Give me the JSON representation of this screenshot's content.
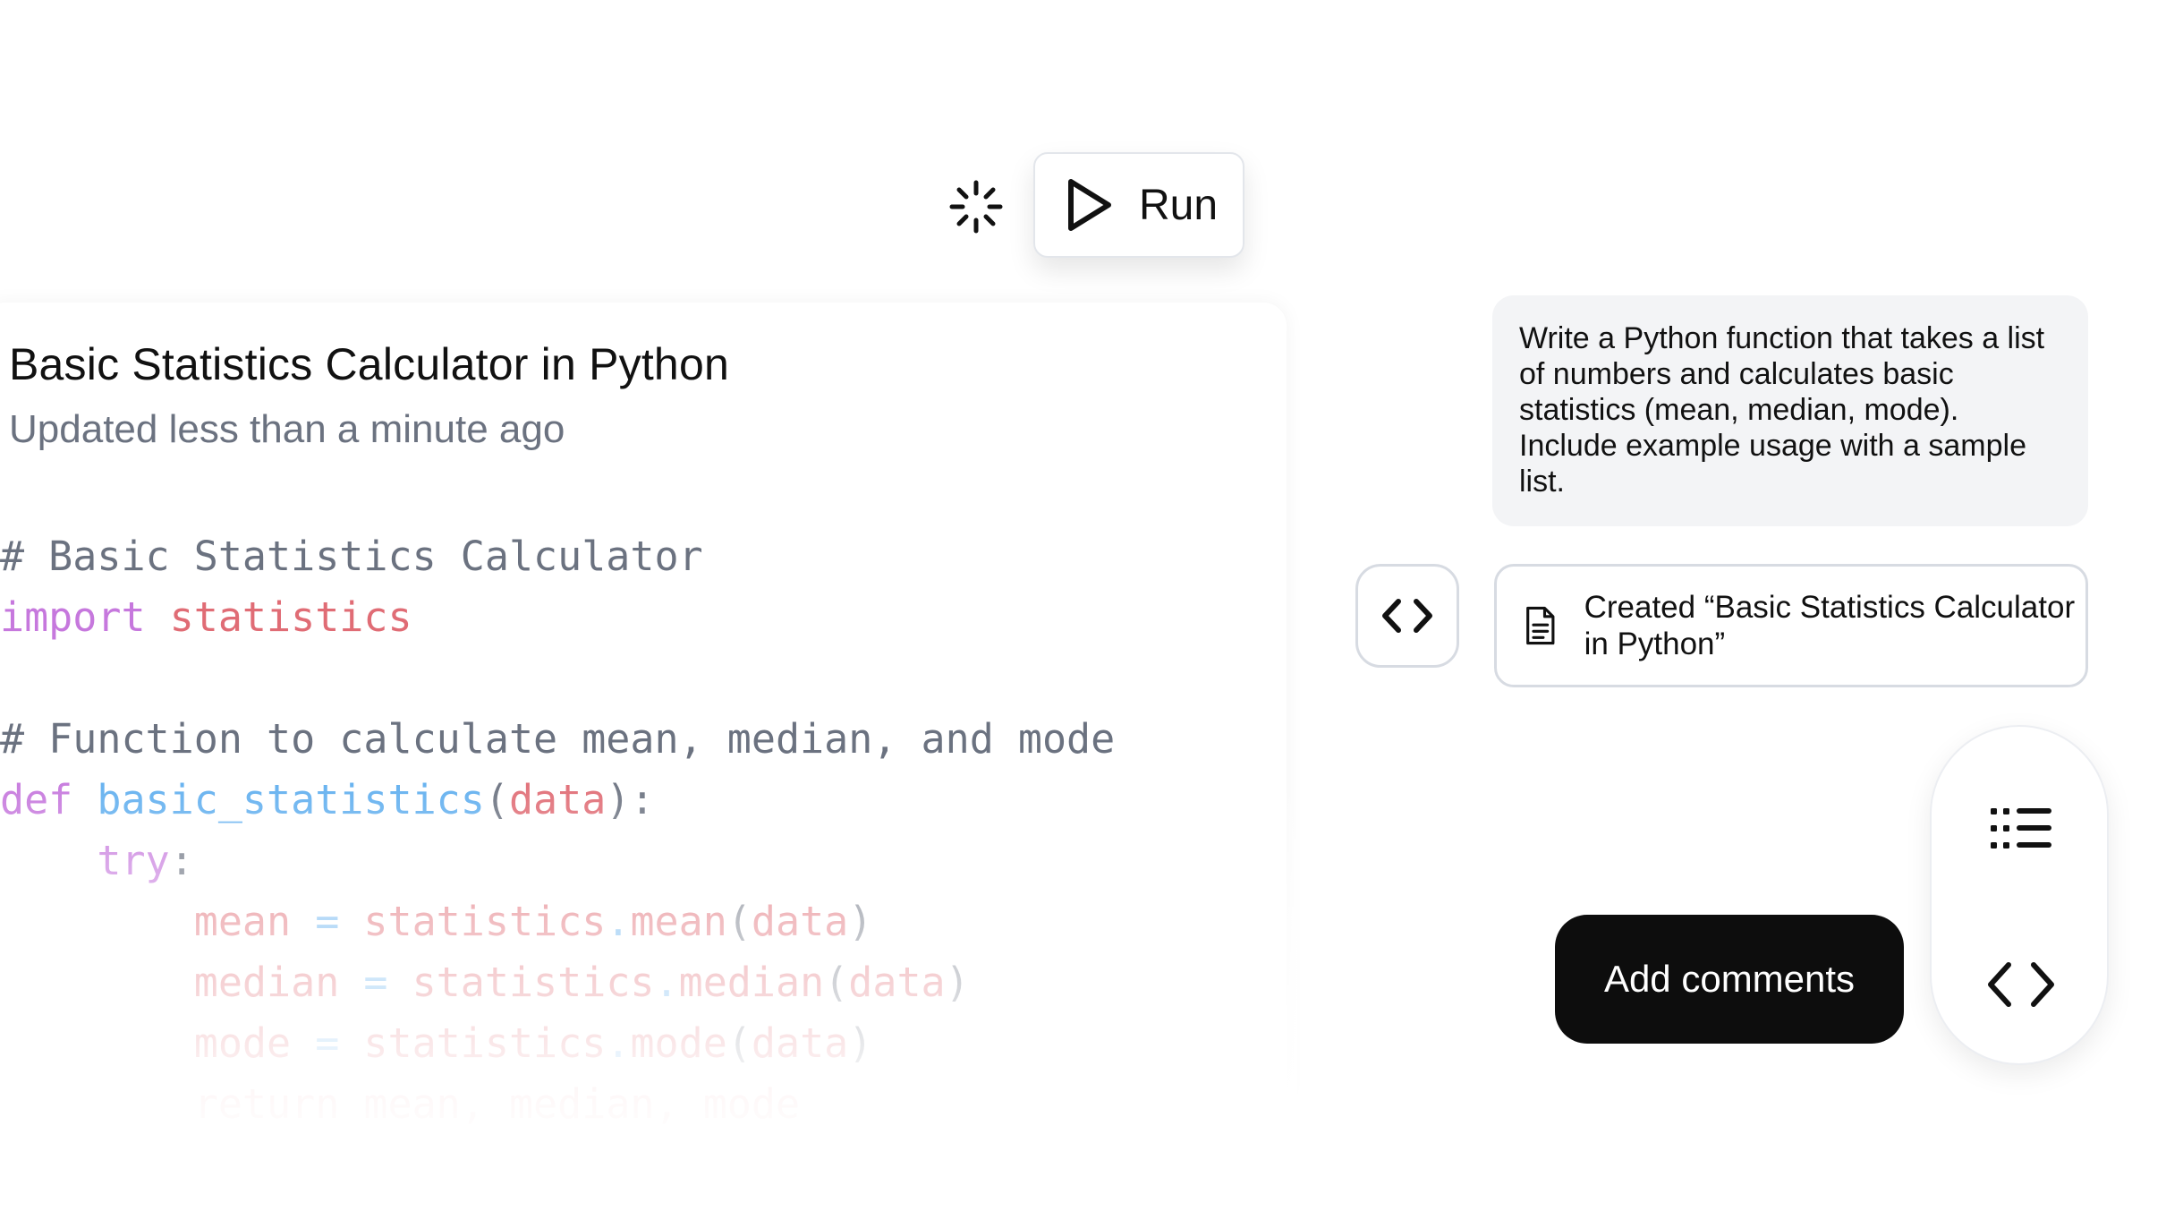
{
  "toolbar": {
    "run_label": "Run"
  },
  "document": {
    "title": "Basic Statistics Calculator in Python",
    "updated": "Updated less than a minute ago",
    "code": {
      "l1": "# Basic Statistics Calculator",
      "l2_kw": "import",
      "l2_mod": " statistics",
      "l4": "# Function to calculate mean, median, and mode",
      "l5_kw": "def",
      "l5_fn": " basic_statistics",
      "l5_open": "(",
      "l5_arg": "data",
      "l5_close": "):",
      "l6_kw": "try",
      "l6_colon": ":",
      "l7_var": "mean",
      "l7_eq": " = ",
      "l7_mod": "statistics",
      "l7_dot": ".",
      "l7_fn": "mean",
      "l7_open": "(",
      "l7_arg": "data",
      "l7_close": ")",
      "l8_var": "median",
      "l8_eq": " = ",
      "l8_mod": "statistics",
      "l8_dot": ".",
      "l8_fn": "median",
      "l8_open": "(",
      "l8_arg": "data",
      "l8_close": ")",
      "l9_var": "mode",
      "l9_eq": " = ",
      "l9_mod": "statistics",
      "l9_dot": ".",
      "l9_fn": "mode",
      "l9_open": "(",
      "l9_arg": "data",
      "l9_close": ")",
      "l10": "return mean, median, mode"
    }
  },
  "chat": {
    "prompt": "Write a Python function that takes a list of numbers and calculates basic statistics (mean, median, mode). Include example usage with a sample list.",
    "created_text": "Created “Basic Statistics Calculator in Python”"
  },
  "actions": {
    "add_comments": "Add comments"
  },
  "icons": {
    "spinner": "loading-spinner-icon",
    "run": "play-icon",
    "code": "code-brackets-icon",
    "document": "document-icon",
    "list": "list-icon"
  }
}
